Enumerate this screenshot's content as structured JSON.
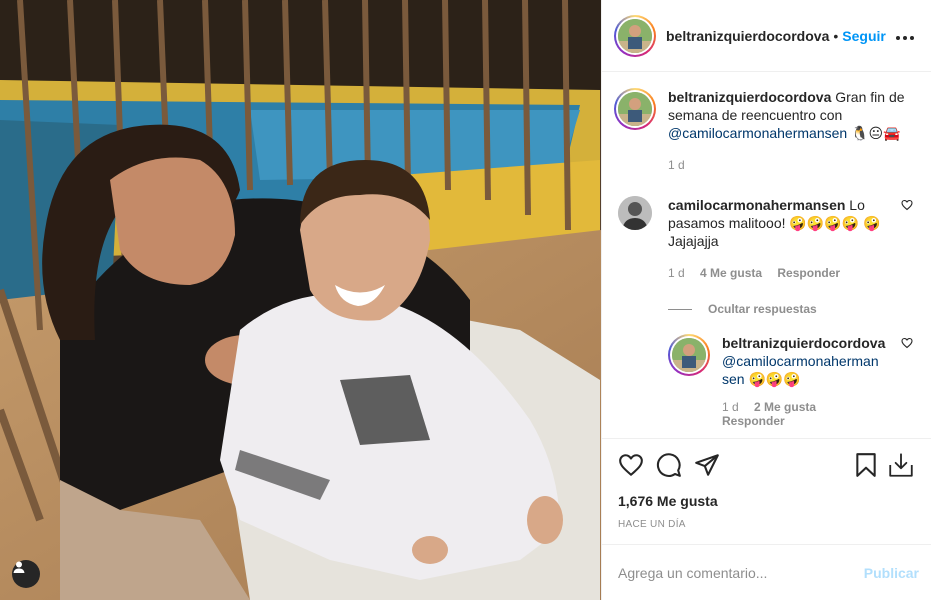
{
  "photo": {
    "alt_description": "",
    "user_tags_icon": "user-icon"
  },
  "header": {
    "username": "beltranizquierdocordova",
    "separator": "•",
    "follow_label": "Seguir",
    "more_icon": "more-horizontal-icon",
    "more_label": "•••"
  },
  "caption": {
    "username": "beltranizquierdocordova",
    "text": "Gran fin de semana de reencuentro con",
    "mention": "@camilocarmonahermansen",
    "emojis": "🐧😐🚘",
    "time": "1 d"
  },
  "comment1": {
    "username": "camilocarmonahermansen",
    "text": "Lo pasamos malitooo!",
    "emojis_a": "🤪🤪🤪🤪",
    "emojis_b": "🤪",
    "text2": "Jajajajja",
    "time": "1 d",
    "likes": "4 Me gusta",
    "reply": "Responder",
    "hide_replies": "Ocultar respuestas"
  },
  "reply1": {
    "username": "beltranizquierdocordova",
    "mention_a": "@camilocarmonaherman",
    "mention_b": "sen",
    "emojis": "🤪🤪🤪",
    "time": "1 d",
    "likes": "2 Me gusta",
    "reply": "Responder"
  },
  "actions": {
    "like_icon": "heart-icon",
    "comment_icon": "comment-icon",
    "share_icon": "send-icon",
    "save_icon": "bookmark-icon",
    "download_icon": "download-icon"
  },
  "likes_count": "1,676 Me gusta",
  "time_ago": "HACE UN DÍA",
  "add_comment": {
    "placeholder": "Agrega un comentario...",
    "publish_label": "Publicar"
  },
  "colors": {
    "link_blue": "#0095f6",
    "publish_disabled": "#b2dffc",
    "mention": "#00376b",
    "muted": "#8e8e8e"
  }
}
